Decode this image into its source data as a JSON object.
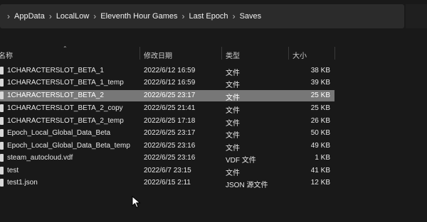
{
  "breadcrumb": {
    "items": [
      "AppData",
      "LocalLow",
      "Eleventh Hour Games",
      "Last Epoch",
      "Saves"
    ],
    "separator": "›"
  },
  "columns": {
    "name": "名称",
    "date": "修改日期",
    "type": "类型",
    "size": "大小"
  },
  "files": [
    {
      "name": "1CHARACTERSLOT_BETA_1",
      "date": "2022/6/12 16:59",
      "type": "文件",
      "size": "38 KB"
    },
    {
      "name": "1CHARACTERSLOT_BETA_1_temp",
      "date": "2022/6/12 16:59",
      "type": "文件",
      "size": "39 KB"
    },
    {
      "name": "1CHARACTERSLOT_BETA_2",
      "date": "2022/6/25 23:17",
      "type": "文件",
      "size": "25 KB",
      "selected": true
    },
    {
      "name": "1CHARACTERSLOT_BETA_2_copy",
      "date": "2022/6/25 21:41",
      "type": "文件",
      "size": "25 KB"
    },
    {
      "name": "1CHARACTERSLOT_BETA_2_temp",
      "date": "2022/6/25 17:18",
      "type": "文件",
      "size": "26 KB"
    },
    {
      "name": "Epoch_Local_Global_Data_Beta",
      "date": "2022/6/25 23:17",
      "type": "文件",
      "size": "50 KB"
    },
    {
      "name": "Epoch_Local_Global_Data_Beta_temp",
      "date": "2022/6/25 23:16",
      "type": "文件",
      "size": "49 KB"
    },
    {
      "name": "steam_autocloud.vdf",
      "date": "2022/6/25 23:16",
      "type": "VDF 文件",
      "size": "1 KB"
    },
    {
      "name": "test",
      "date": "2022/6/7 23:15",
      "type": "文件",
      "size": "41 KB"
    },
    {
      "name": "test1.json",
      "date": "2022/6/15 2:11",
      "type": "JSON 源文件",
      "size": "12 KB"
    }
  ],
  "colors": {
    "background": "#191919",
    "address_bar": "#2b2b2b",
    "selected_row": "#777777"
  }
}
